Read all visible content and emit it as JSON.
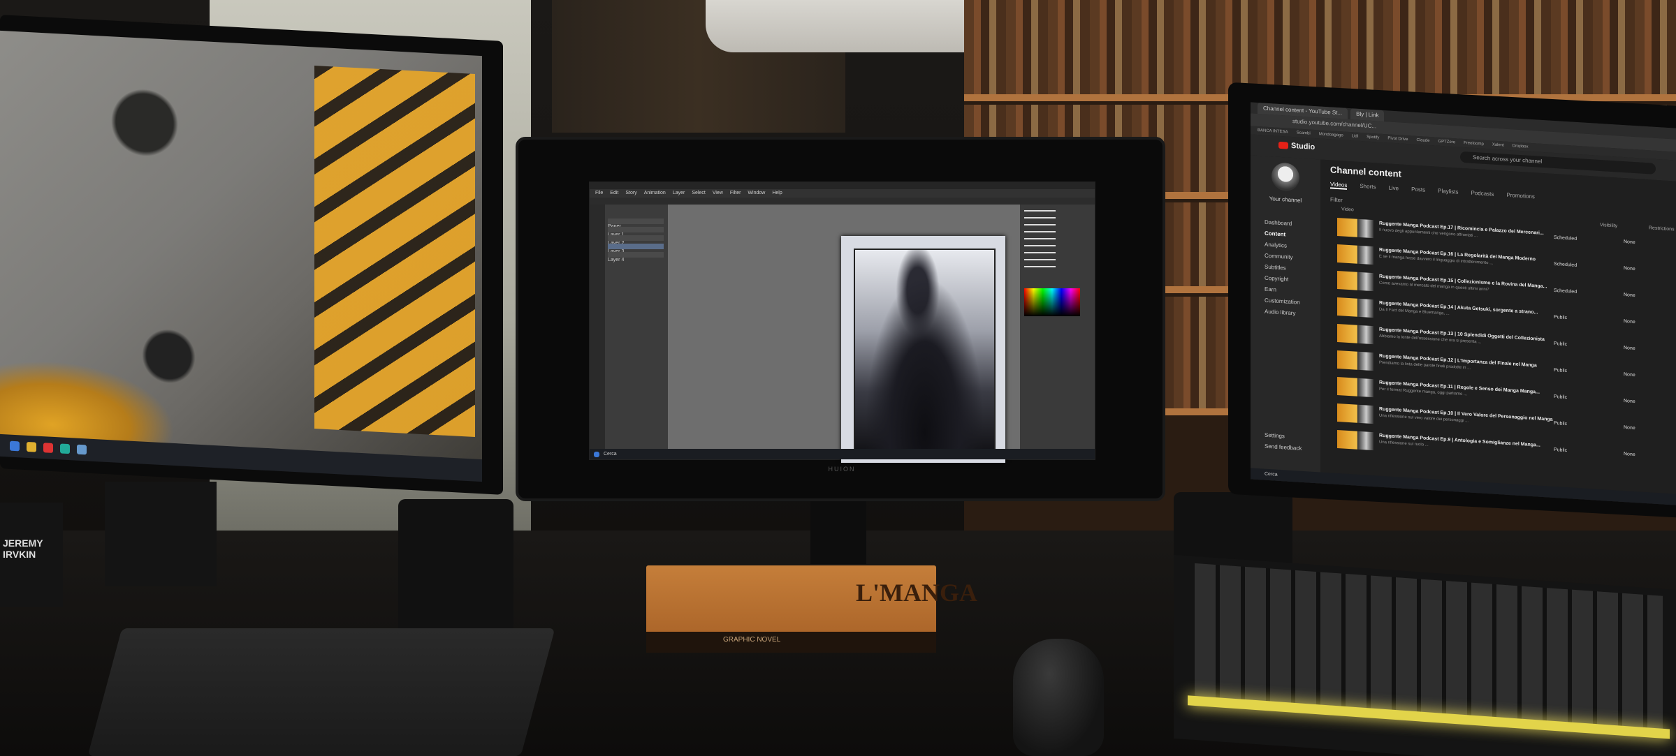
{
  "tablet": {
    "brand": "HUION",
    "menus": [
      "File",
      "Edit",
      "Story",
      "Animation",
      "Layer",
      "Select",
      "View",
      "Filter",
      "Window",
      "Help"
    ],
    "taskbar_search": "Cerca",
    "layer_names": [
      "Paper",
      "Layer 1",
      "Layer 2",
      "Layer 3",
      "Layer 4"
    ]
  },
  "browser": {
    "tabs": [
      "Channel content - YouTube St...",
      "Bly | Link"
    ],
    "url": "studio.youtube.com/channel/UC...",
    "bookmarks": [
      "BANCA INTESA",
      "Scambi",
      "Mondoagogo",
      "Lidl",
      "Spotify",
      "Pivot Drive",
      "Claude",
      "GPTZero",
      "Freeloomp",
      "Xalent",
      "Dropbox"
    ]
  },
  "studio": {
    "label": "Studio",
    "search_placeholder": "Search across your channel",
    "your_channel": "Your channel",
    "sidebar": [
      "Dashboard",
      "Content",
      "Analytics",
      "Community",
      "Subtitles",
      "Copyright",
      "Earn",
      "Customization",
      "Audio library",
      "Settings",
      "Send feedback"
    ],
    "title": "Channel content",
    "tabs": [
      "Videos",
      "Shorts",
      "Live",
      "Posts",
      "Playlists",
      "Podcasts",
      "Promotions"
    ],
    "filter": "Filter",
    "col_video": "Video",
    "col_visibility": "Visibility",
    "col_restrictions": "Restrictions",
    "rows": [
      {
        "title": "Ruggente Manga Podcast Ep.17 | Ricomincia e Palazzo dei Mercenari...",
        "desc": "Il nuovo degli appuntamenti che vengono affrontati ...",
        "visibility": "Scheduled",
        "restrictions": "None"
      },
      {
        "title": "Ruggente Manga Podcast Ep.16 | La Regolarità del Manga Moderno",
        "desc": "E se il manga fosse davvero il linguaggio di intrattenimento ...",
        "visibility": "Scheduled",
        "restrictions": "None"
      },
      {
        "title": "Ruggente Manga Podcast Ep.15 | Collezionismo e la Rovina del Manga...",
        "desc": "Come avevamo al mercato del manga in questi ultimi anni?",
        "visibility": "Scheduled",
        "restrictions": "None"
      },
      {
        "title": "Ruggente Manga Podcast Ep.14 | Akuta Getsuki, sorgente a strano...",
        "desc": "Da Il Fact del Manga e Bluemanga, ...",
        "visibility": "Public",
        "restrictions": "None"
      },
      {
        "title": "Ruggente Manga Podcast Ep.13 | 10 Splendidi Oggetti del Collezionista",
        "desc": "Abbiamo la lente dell'ossessione che ora si presenta ...",
        "visibility": "Public",
        "restrictions": "None"
      },
      {
        "title": "Ruggente Manga Podcast Ep.12 | L'Importanza del Finale nel Manga",
        "desc": "Prendiamo la lista delle parole finali prodotte in ...",
        "visibility": "Public",
        "restrictions": "None"
      },
      {
        "title": "Ruggente Manga Podcast Ep.11 | Regole e Senso dei Manga Manga...",
        "desc": "Per il format Ruggente manga, oggi parliamo ...",
        "visibility": "Public",
        "restrictions": "None"
      },
      {
        "title": "Ruggente Manga Podcast Ep.10 | Il Vero Valore del Personaggio nel Manga",
        "desc": "Una riflessione sul vero valore dei personaggi ...",
        "visibility": "Public",
        "restrictions": "None"
      },
      {
        "title": "Ruggente Manga Podcast Ep.9 | Antologia e Somiglianze nel Manga...",
        "desc": "Una riflessione sul ruolo ...",
        "visibility": "Public",
        "restrictions": "None"
      }
    ],
    "taskbar_search": "Cerca"
  },
  "book": {
    "title": "L'MANGA",
    "spine": "GRAPHIC NOVEL"
  },
  "left_book": {
    "text": "JEREMY\nIRVKIN"
  },
  "colors": {
    "accent_yellow": "#e4a42a",
    "yt_red": "#e62117",
    "keyboard_glow": "#e2d44a"
  }
}
